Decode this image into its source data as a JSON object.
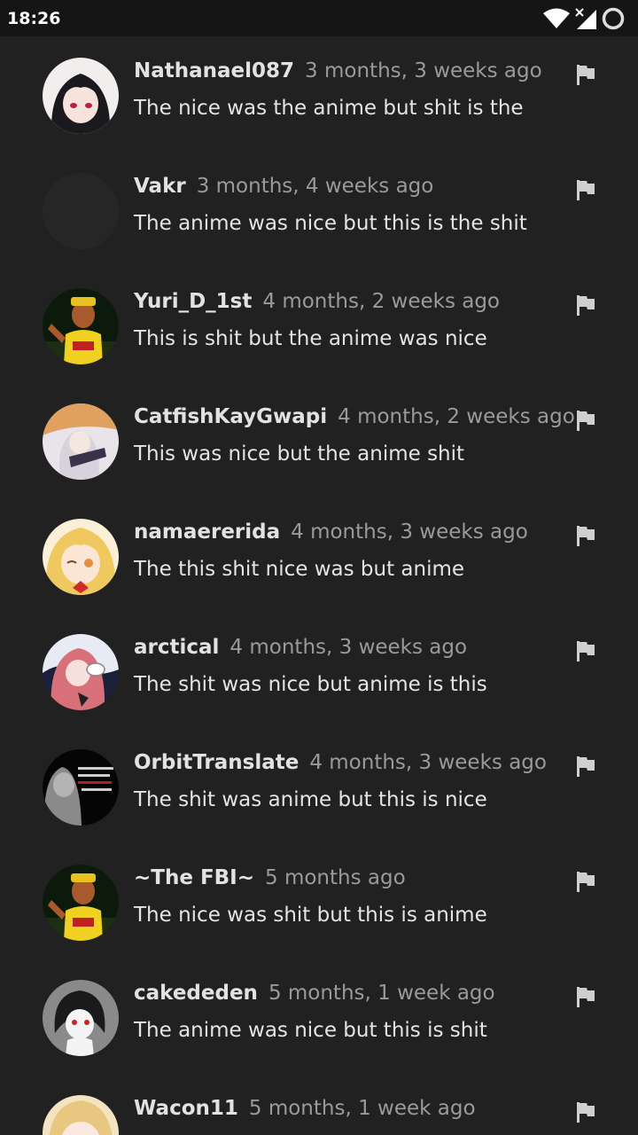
{
  "status_bar": {
    "time": "18:26",
    "icons": [
      "wifi-icon",
      "signal-off-icon",
      "battery-icon"
    ]
  },
  "colors": {
    "background": "#212121",
    "status_bar": "#151515",
    "username": "#e2e2e2",
    "timestamp": "#9a9a9a",
    "text": "#e4e4e4",
    "flag": "#cfcfcf"
  },
  "comments": [
    {
      "username": "Nathanael087",
      "time": "3 months, 3 weeks ago",
      "text": "The nice was the anime but shit is the",
      "flag_icon": "flag-icon"
    },
    {
      "username": "Vakr",
      "time": "3 months, 4 weeks ago",
      "text": "The anime was nice but this is the shit",
      "flag_icon": "flag-icon"
    },
    {
      "username": "Yuri_D_1st",
      "time": "4 months, 2 weeks ago",
      "text": "This is shit but the anime was nice",
      "flag_icon": "flag-icon"
    },
    {
      "username": "CatfishKayGwapi",
      "time": "4 months, 2 weeks ago",
      "text": "This was nice but the anime shit",
      "flag_icon": "flag-icon"
    },
    {
      "username": "namaererida",
      "time": "4 months, 3 weeks ago",
      "text": "The this shit nice was but anime",
      "flag_icon": "flag-icon"
    },
    {
      "username": "arctical",
      "time": "4 months, 3 weeks ago",
      "text": "The shit was nice but anime is this",
      "flag_icon": "flag-icon"
    },
    {
      "username": "OrbitTranslate",
      "time": "4 months, 3 weeks ago",
      "text": "The shit was anime but this is nice",
      "flag_icon": "flag-icon"
    },
    {
      "username": "~The FBI~",
      "time": "5 months ago",
      "text": "The nice was shit but this is anime",
      "flag_icon": "flag-icon"
    },
    {
      "username": "cakededen",
      "time": "5 months, 1 week ago",
      "text": "The anime was nice but this is shit",
      "flag_icon": "flag-icon"
    },
    {
      "username": "Wacon11",
      "time": "5 months, 1 week ago",
      "text": "",
      "flag_icon": "flag-icon"
    }
  ]
}
